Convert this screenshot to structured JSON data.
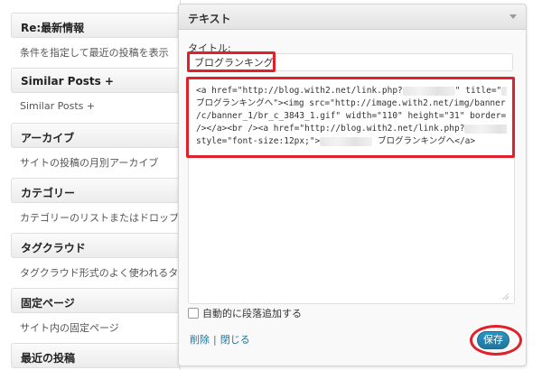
{
  "widgets": [
    {
      "title": "Re:最新情報",
      "desc": "条件を指定して最近の投稿を表示"
    },
    {
      "title": "Similar Posts +",
      "desc": "Similar Posts +"
    },
    {
      "title": "アーカイブ",
      "desc": "サイトの投稿の月別アーカイブ"
    },
    {
      "title": "カテゴリー",
      "desc": "カテゴリーのリストまたはドロップダウン"
    },
    {
      "title": "タグクラウド",
      "desc": "タグクラウド形式のよく使われるタグ一覧"
    },
    {
      "title": "固定ページ",
      "desc": "サイト内の固定ページ"
    },
    {
      "title": "最近の投稿",
      "desc": ""
    }
  ],
  "dialog": {
    "title": "テキスト",
    "title_label": "タイトル:",
    "title_value": "ブログランキング",
    "content_lines": {
      "l1a": "<a href=\"http://blog.with2.net/link.php?",
      "l1b": "\" title=\"",
      "l2": "ブログランキングへ\"><img src=\"http://image.with2.net/img/banner",
      "l3": "/c/banner_1/br_c_3843_1.gif\" width=\"110\" height=\"31\" border=\"0\"",
      "l4a": "/></a><br /><a href=\"http://blog.with2.net/link.php?",
      "l4b": "\"",
      "l5a": "style=\"font-size:12px;\">",
      "l5b": "ブログランキングへ</a>"
    },
    "auto_paragraph_label": "自動的に段落追加する",
    "delete_label": "削除",
    "close_label": "閉じる",
    "separator": "|",
    "save_label": "保存"
  },
  "colors": {
    "accent": "#21759b",
    "highlight": "#e0202a"
  }
}
